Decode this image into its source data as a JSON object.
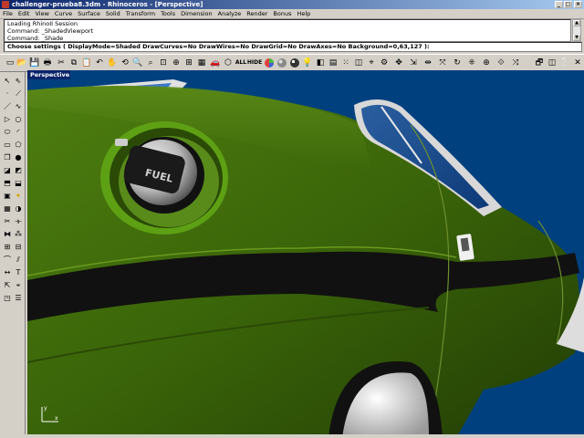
{
  "window": {
    "title": "challenger-prueba8.3dm - Rhinoceros - [Perspective]",
    "controls": {
      "minimize": "_",
      "maximize": "□",
      "close": "×"
    }
  },
  "menu": [
    "File",
    "Edit",
    "View",
    "Curve",
    "Surface",
    "Solid",
    "Transform",
    "Tools",
    "Dimension",
    "Analyze",
    "Render",
    "Bonus",
    "Help"
  ],
  "command_history": [
    "Loading RhinoII Session",
    "Command: _ShadedViewport",
    "Command: _Shade"
  ],
  "command_prompt": "Choose settings ( DisplayMode=Shaded  DrawCurves=No  DrawWires=No  DrawGrid=No  DrawAxes=No  Background=0,63,127 ):",
  "toolbar": {
    "icons": [
      "new-file-icon",
      "open-icon",
      "save-icon",
      "print-icon",
      "cut-icon",
      "copy-icon",
      "paste-icon",
      "undo-icon",
      "pan-icon",
      "rotate-view-icon",
      "zoom-icon",
      "zoom-window-icon",
      "zoom-extents-icon",
      "zoom-selected-icon",
      "four-viewports-icon",
      "grid-icon",
      "car-icon",
      "mesh-icon",
      "render-icon",
      "all-label-icon",
      "hide-label-icon",
      "color-wheel-icon",
      "sphere-shaded-icon",
      "sphere-render-icon",
      "light-icon",
      "layer-icon",
      "properties-icon",
      "point-edit-icon",
      "move-icon",
      "copy-tool-icon",
      "mirror-icon",
      "scale-icon",
      "analyze-icon",
      "options-icon",
      "help-icon",
      "window-icon",
      "close-icon"
    ],
    "text_labels": {
      "all": "ALL",
      "hide": "HIDE"
    }
  },
  "viewport": {
    "label": "Perspective",
    "background": "#00407f",
    "model_color": "#3f6a0c",
    "axes": {
      "x": "x",
      "y": "y"
    }
  }
}
